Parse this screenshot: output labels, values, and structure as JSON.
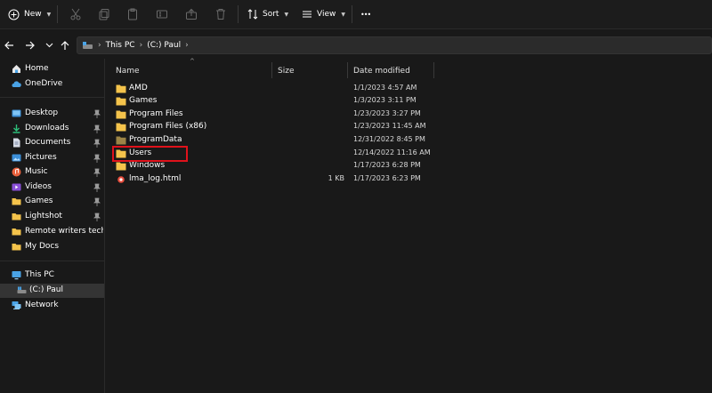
{
  "toolbar": {
    "new_label": "New",
    "sort_label": "Sort",
    "view_label": "View",
    "more_label": "•••"
  },
  "address": {
    "crumbs": [
      "This PC",
      "(C:) Paul"
    ]
  },
  "sidebar": {
    "items": [
      {
        "label": "Home",
        "icon": "home-icon"
      },
      {
        "label": "OneDrive",
        "icon": "cloud-icon"
      },
      {
        "label": "Desktop",
        "icon": "desktop-icon",
        "pinned": true
      },
      {
        "label": "Downloads",
        "icon": "download-icon",
        "pinned": true
      },
      {
        "label": "Documents",
        "icon": "document-icon",
        "pinned": true
      },
      {
        "label": "Pictures",
        "icon": "pictures-icon",
        "pinned": true
      },
      {
        "label": "Music",
        "icon": "music-icon",
        "pinned": true
      },
      {
        "label": "Videos",
        "icon": "videos-icon",
        "pinned": true
      },
      {
        "label": "Games",
        "icon": "folder-icon",
        "pinned": true
      },
      {
        "label": "Lightshot",
        "icon": "folder-icon",
        "pinned": true
      },
      {
        "label": "Remote writers tech",
        "icon": "folder-icon",
        "pinned": true
      },
      {
        "label": "My Docs",
        "icon": "folder-icon"
      },
      {
        "label": "This PC",
        "icon": "computer-icon"
      },
      {
        "label": "(C:) Paul",
        "icon": "drive-icon",
        "selected": true
      },
      {
        "label": "Network",
        "icon": "network-icon"
      }
    ]
  },
  "columns": {
    "name": "Name",
    "size": "Size",
    "date": "Date modified"
  },
  "files": [
    {
      "name": "AMD",
      "date": "1/1/2023 4:57 AM",
      "size": "",
      "type": "folder"
    },
    {
      "name": "Games",
      "date": "1/3/2023 3:11 PM",
      "size": "",
      "type": "folder"
    },
    {
      "name": "Program Files",
      "date": "1/23/2023 3:27 PM",
      "size": "",
      "type": "folder"
    },
    {
      "name": "Program Files (x86)",
      "date": "1/23/2023 11:45 AM",
      "size": "",
      "type": "folder"
    },
    {
      "name": "ProgramData",
      "date": "12/31/2022 8:45 PM",
      "size": "",
      "type": "folder-hidden"
    },
    {
      "name": "Users",
      "date": "12/14/2022 11:16 AM",
      "size": "",
      "type": "folder"
    },
    {
      "name": "Windows",
      "date": "1/17/2023 6:28 PM",
      "size": "",
      "type": "folder"
    },
    {
      "name": "lma_log.html",
      "date": "1/17/2023 6:23 PM",
      "size": "1 KB",
      "type": "html"
    }
  ],
  "colors": {
    "background": "#191919",
    "folder": "#f4c34b",
    "highlight": "#e0121b",
    "accent": "#4aa3e6"
  }
}
